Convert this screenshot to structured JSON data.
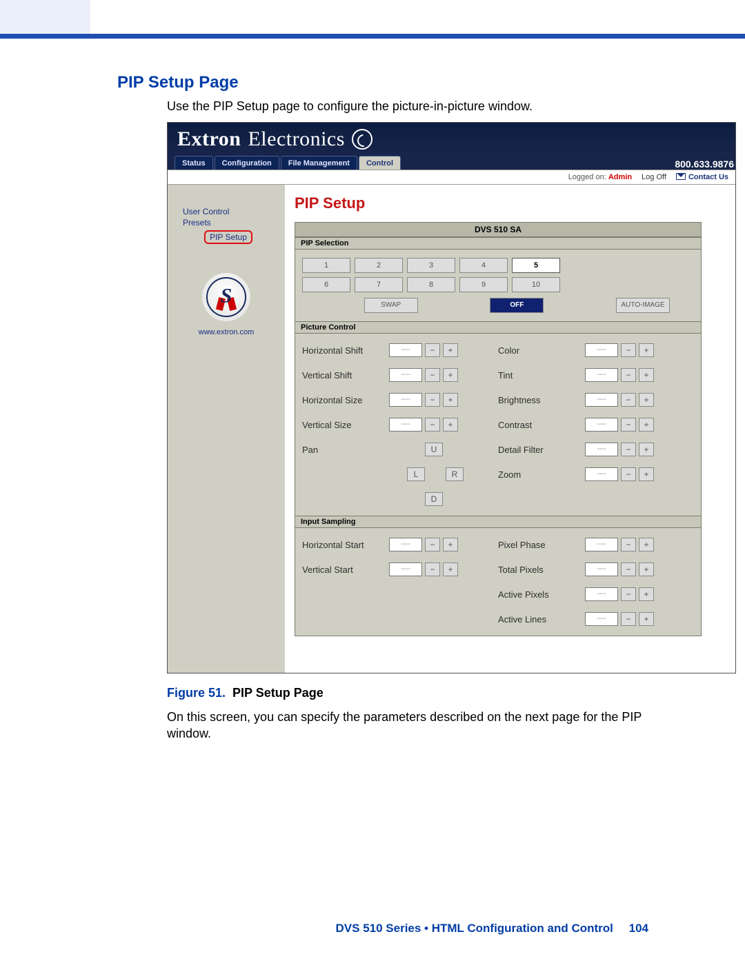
{
  "page": {
    "heading": "PIP Setup Page",
    "intro": "Use the PIP Setup page to configure the picture-in-picture window.",
    "figure_prefix": "Figure 51.",
    "figure_title": "PIP Setup Page",
    "after": "On this screen, you can specify the parameters described on the next page for the PIP window.",
    "footer_text": "DVS 510 Series • HTML Configuration and Control",
    "footer_page": "104"
  },
  "app": {
    "brand_bold": "Extron",
    "brand_light": "Electronics",
    "phone": "800.633.9876",
    "tabs": {
      "status": "Status",
      "config": "Configuration",
      "file": "File Management",
      "control": "Control"
    },
    "status": {
      "logged_on": "Logged on: ",
      "user": "Admin",
      "logoff": "Log Off",
      "contact": "Contact Us"
    },
    "sidebar": {
      "user_control": "User Control",
      "presets": "Presets",
      "pip_setup": "PIP Setup",
      "url": "www.extron.com"
    },
    "main_heading": "PIP Setup",
    "device_title": "DVS 510 SA",
    "groups": {
      "pipsel": "PIP Selection",
      "picctl": "Picture Control",
      "inputsamp": "Input Sampling"
    },
    "numbers": {
      "1": "1",
      "2": "2",
      "3": "3",
      "4": "4",
      "5": "5",
      "6": "6",
      "7": "7",
      "8": "8",
      "9": "9",
      "10": "10"
    },
    "buttons": {
      "swap": "SWAP",
      "off": "OFF",
      "autoimage": "AUTO-IMAGE"
    },
    "valplaceholder": "----",
    "minus": "−",
    "plus": "+",
    "dpad": {
      "u": "U",
      "l": "L",
      "r": "R",
      "d": "D"
    },
    "labels": {
      "hshift": "Horizontal Shift",
      "vshift": "Vertical Shift",
      "hsize": "Horizontal Size",
      "vsize": "Vertical Size",
      "pan": "Pan",
      "color": "Color",
      "tint": "Tint",
      "bright": "Brightness",
      "contrast": "Contrast",
      "detail": "Detail Filter",
      "zoom": "Zoom",
      "hstart": "Horizontal Start",
      "vstart": "Vertical Start",
      "pphase": "Pixel Phase",
      "tpixels": "Total Pixels",
      "apixels": "Active Pixels",
      "alines": "Active Lines"
    }
  }
}
